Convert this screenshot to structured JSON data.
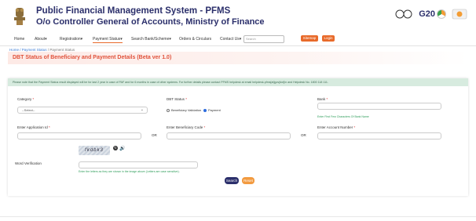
{
  "header": {
    "title": "Public Financial Management System - PFMS",
    "subtitle": "O/o Controller General of Accounts, Ministry of Finance",
    "g20_label": "G20"
  },
  "nav": {
    "items": [
      "Home",
      "About▾",
      "Registration▾",
      "Payment Status▾",
      "Search Bank/Scheme▾",
      "Orders & Circulars",
      "Contact Us▾"
    ],
    "search_placeholder": "Search",
    "sitemap_label": "Sitemap",
    "login_label": "Login"
  },
  "breadcrumb": {
    "home": "Home",
    "sep": " / ",
    "section": "Payment Status",
    "current": " / Payment Status"
  },
  "page_title": "DBT Status of Beneficiary and Payment Details (Beta ver 1.0)",
  "note": "Please note that the Payment Status result displayed will be for last 2 year in case of PAF and for 6 months in case of other systems. For further details please contact PFMS helpdesk at email helpdesk-pfms[at]gov[dot]in and Helpdesk No. 1800 118 111.",
  "form": {
    "category_label": "Category",
    "category_value": "--Select--",
    "dbt_status_label": "DBT Status",
    "dbt_options": [
      "Beneficiary Validation",
      "Payment"
    ],
    "dbt_selected": "Payment",
    "bank_label": "Bank",
    "bank_hint": "Enter First Few Characters Of Bank Name",
    "application_label": "Enter Application Id",
    "or_text": "OR",
    "beneficiary_label": "Enter Beneficiary Code",
    "account_label": "Enter Account Number",
    "captcha_text": "fkdbk3",
    "word_verification_label": "Word Verification",
    "captcha_hint": "Enter the letters as they are shown in the image above (Letters are case sensitive).",
    "search_button": "Search",
    "reset_button": "Reset"
  },
  "colors": {
    "brand_navy": "#2b2f6b",
    "accent_orange": "#e86a2a",
    "title_red": "#e0513a",
    "note_bg": "#d7ebdf",
    "hint_green": "#2e9d5a"
  },
  "icons": [
    "national-emblem-icon",
    "swachh-bharat-icon",
    "g20-logo-icon",
    "chevron-down-icon",
    "refresh-icon",
    "speaker-icon"
  ]
}
